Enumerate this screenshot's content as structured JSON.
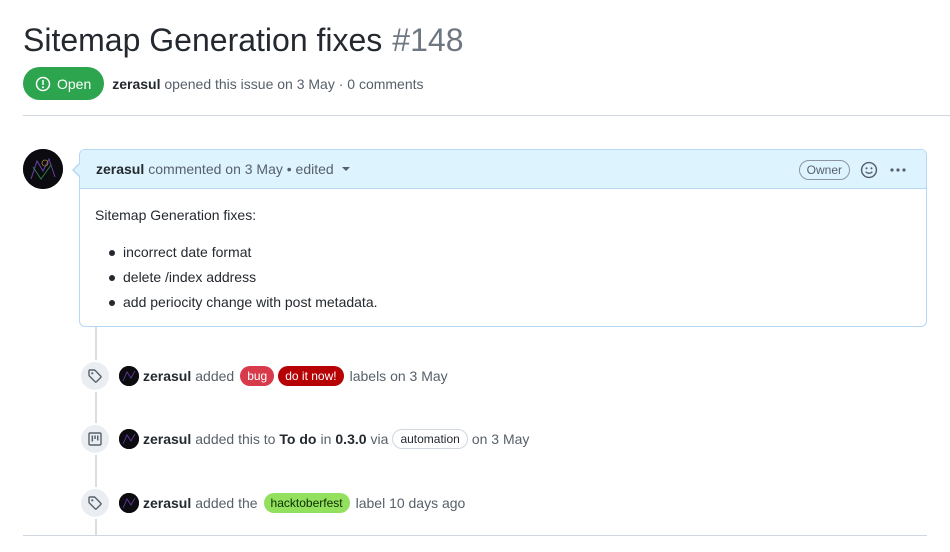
{
  "issue": {
    "title": "Sitemap Generation fixes",
    "number": "#148",
    "state": "Open",
    "author": "zerasul",
    "opened_text": "opened this issue on 3 May · 0 comments"
  },
  "comment": {
    "author": "zerasul",
    "meta": "commented on 3 May • edited",
    "role": "Owner",
    "intro": "Sitemap Generation fixes:",
    "items": [
      "incorrect date format",
      "delete /index address",
      "add periocity change with post metadata."
    ]
  },
  "timeline": [
    {
      "icon": "tag-icon",
      "actor": "zerasul",
      "verb": "added",
      "labels": [
        {
          "text": "bug",
          "color": "#d73a4a"
        },
        {
          "text": "do it now!",
          "color": "#b60205"
        }
      ],
      "suffix": "labels on 3 May"
    },
    {
      "icon": "project-icon",
      "actor": "zerasul",
      "verb": "added this to",
      "column": "To do",
      "in": "in",
      "project": "0.3.0",
      "via": "via",
      "app": "automation",
      "suffix": "on 3 May"
    },
    {
      "icon": "tag-icon",
      "actor": "zerasul",
      "verb": "added the",
      "labels": [
        {
          "text": "hacktoberfest",
          "color": "#93e05e"
        }
      ],
      "suffix": "label 10 days ago"
    }
  ],
  "colors": {
    "open_green": "#2da44e",
    "header_blue": "#ddf4ff"
  }
}
